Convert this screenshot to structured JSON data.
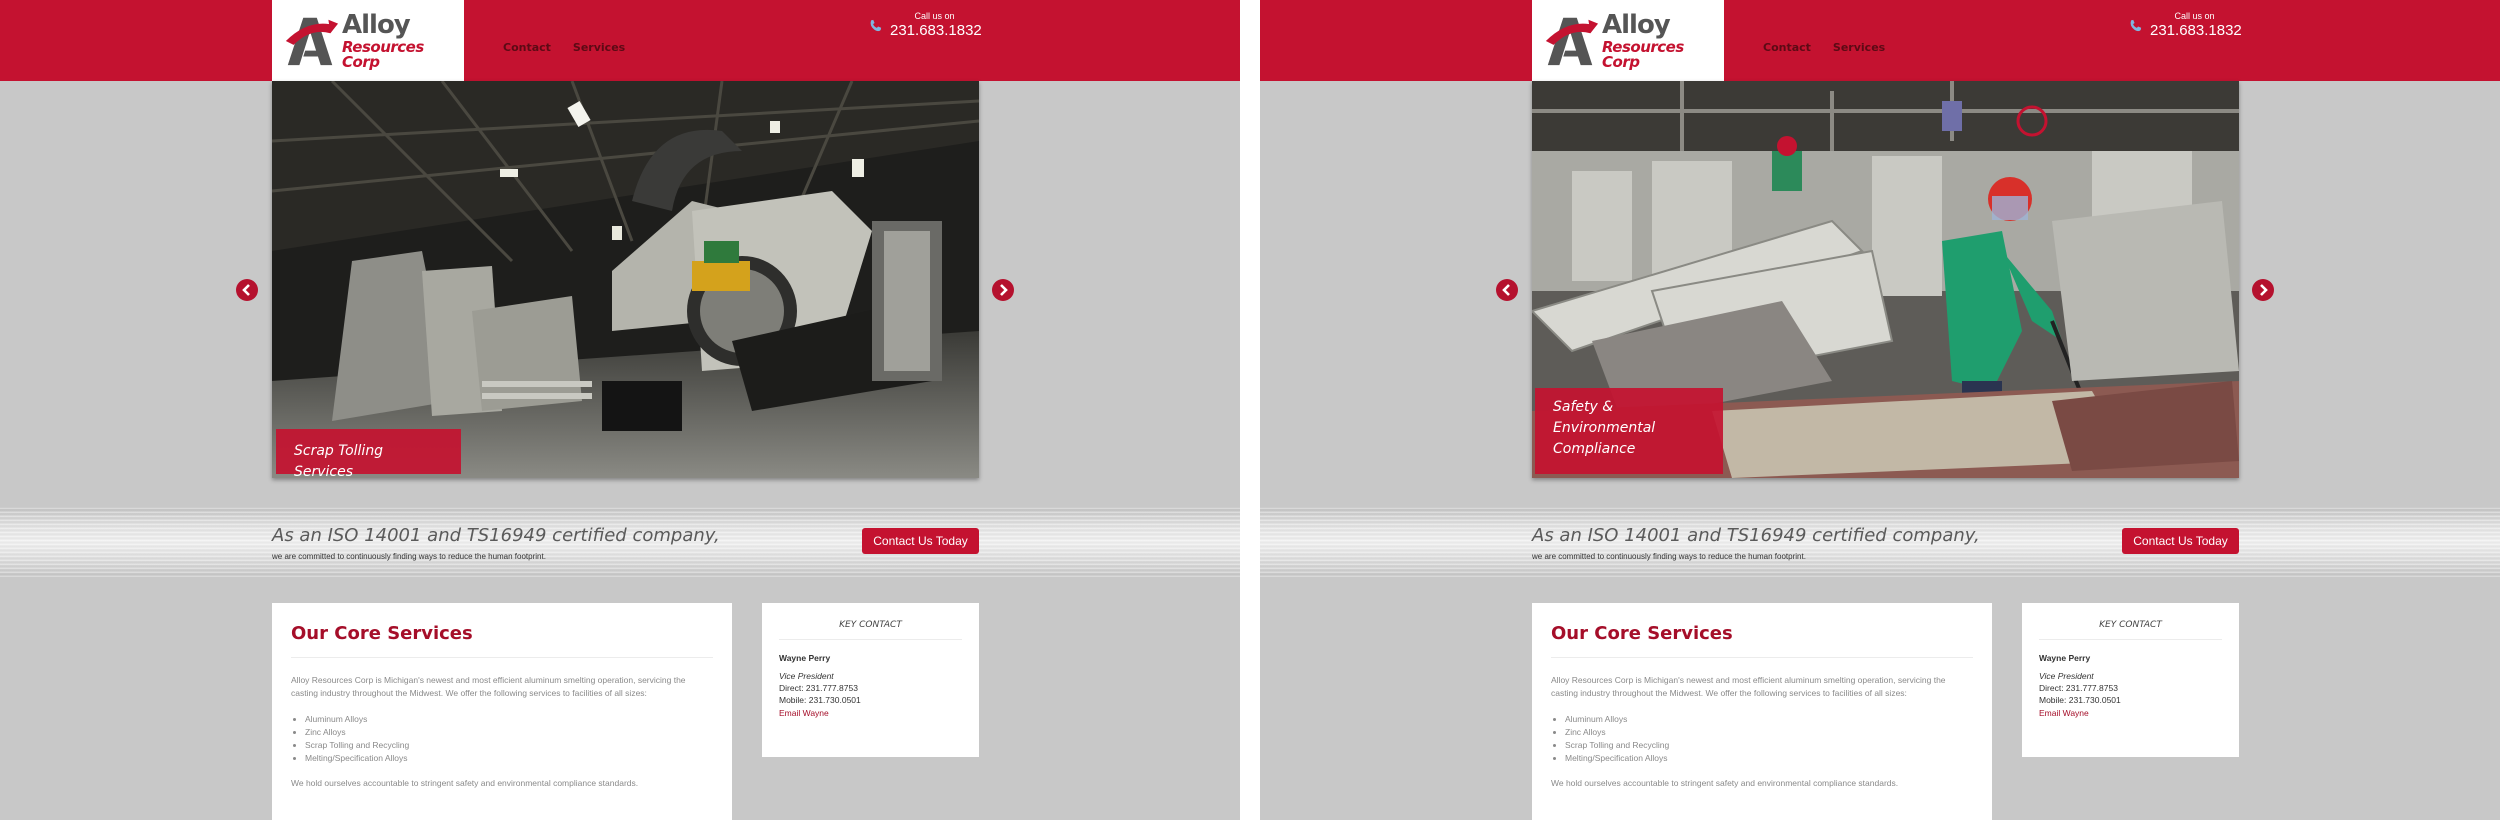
{
  "brand": {
    "name": "Alloy",
    "sub": "Resources Corp",
    "primary_color": "#c41230",
    "logo_icon": "alloy-a-logo"
  },
  "nav": {
    "contact": "Contact",
    "services": "Services"
  },
  "callus": {
    "label": "Call us on",
    "number": "231.683.1832",
    "icon": "phone-icon"
  },
  "panels": [
    {
      "slide": {
        "caption": "Scrap Tolling Services",
        "image": "industrial foundry interior with tilting furnace"
      }
    },
    {
      "slide": {
        "caption": "Safety & Environmental Compliance",
        "image": "worker in green coat and red hard hat skimming molten aluminum"
      }
    }
  ],
  "band": {
    "headline": "As an ISO 14001 and TS16949 certified company,",
    "subline": "we are committed to continuously finding ways to reduce the human footprint.",
    "cta": "Contact Us Today"
  },
  "services": {
    "title": "Our Core Services",
    "intro": "Alloy Resources Corp is Michigan's newest and most efficient aluminum smelting operation, servicing the casting industry throughout the Midwest. We offer the following services to facilities of all sizes:",
    "items": [
      "Aluminum Alloys",
      "Zinc Alloys",
      "Scrap Tolling and Recycling",
      "Melting/Specification Alloys"
    ],
    "footer": "We hold ourselves accountable to stringent safety and environmental compliance standards."
  },
  "key_contact": {
    "heading": "KEY CONTACT",
    "name": "Wayne Perry",
    "role": "Vice President",
    "direct": "Direct: 231.777.8753",
    "mobile": "Mobile: 231.730.0501",
    "email_label": "Email Wayne"
  }
}
